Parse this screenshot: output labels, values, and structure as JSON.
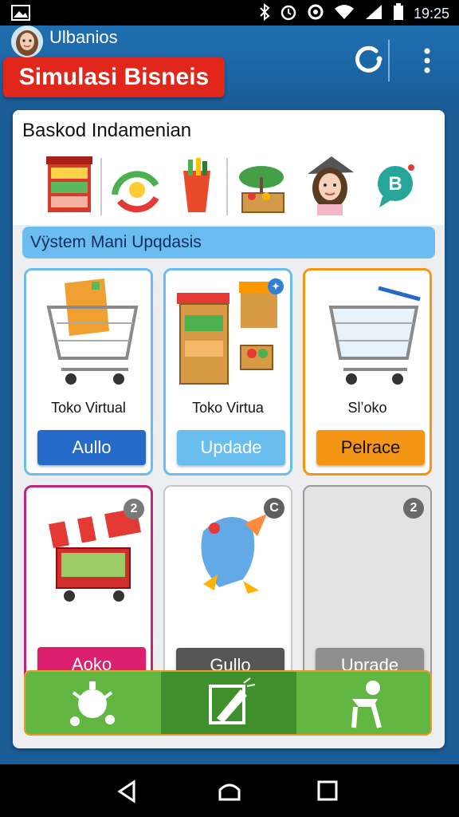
{
  "status_bar": {
    "time": "19:25"
  },
  "header": {
    "user_name": "Ulbanios",
    "app_title": "Simulasi Bisneis"
  },
  "categories": {
    "title": "Baskod Indamenian"
  },
  "section": {
    "title": "Vÿstem Mani Upqdasis"
  },
  "tiles": [
    {
      "label": "Toko Virtual",
      "button": "Aullo"
    },
    {
      "label": "Toko Virtua",
      "button": "Updade"
    },
    {
      "label": "Slʼoko",
      "button": "Pelrace"
    },
    {
      "label": "",
      "button": "Aoko",
      "badge": "2"
    },
    {
      "label": "",
      "button": "Gullo",
      "badge": "C"
    },
    {
      "label": "",
      "button": "Uprade",
      "badge": "2"
    }
  ],
  "colors": {
    "app_bar": "#1f6fb1",
    "title_badge": "#e1261c",
    "section_header": "#6bbcf0",
    "btn_blue": "#2569c9",
    "btn_light_blue": "#69bdef",
    "btn_orange": "#f49516",
    "btn_magenta": "#dc1f6e",
    "btn_dark_gray": "#555555",
    "btn_gray": "#8f8f8f",
    "bottom_tabs": "#62b743"
  },
  "icons": {
    "status_left": "image-icon",
    "status_right": [
      "bluetooth-icon",
      "alarm-icon",
      "data-saver-icon",
      "wifi-icon",
      "signal-icon",
      "battery-icon"
    ],
    "header": [
      "avatar",
      "refresh-icon",
      "more-vert-icon"
    ],
    "categories": [
      "shop-shelf-icon",
      "chart-growth-icon",
      "paint-cup-icon",
      "market-stall-icon",
      "woman-avatar-icon",
      "chat-b-icon"
    ],
    "tabs": [
      "gear-bug-icon",
      "edit-paper-icon",
      "person-desk-icon"
    ],
    "nav": [
      "back-icon",
      "home-icon",
      "recents-icon"
    ]
  }
}
